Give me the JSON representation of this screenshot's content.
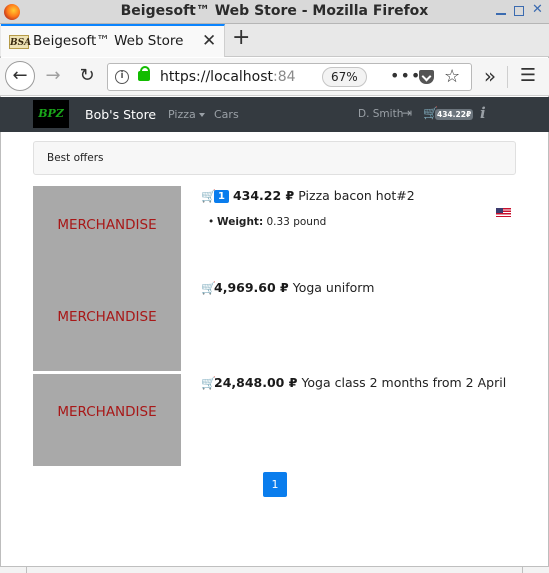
{
  "window": {
    "title": "Beigesoft™ Web Store - Mozilla Firefox",
    "minimize_icon": "minimize-icon",
    "maximize_icon": "maximize-icon",
    "close_glyph": "✕"
  },
  "tab": {
    "favicon_text": "BSA",
    "title": "Beigesoft™ Web Store",
    "close_glyph": "✕",
    "new_tab_glyph": "+"
  },
  "toolbar": {
    "back_glyph": "←",
    "forward_glyph": "→",
    "reload_glyph": "↻",
    "url_main": "https://localhost",
    "url_dim": ":84",
    "zoom": "67%",
    "more_glyph": "•••",
    "star_glyph": "☆",
    "overflow_glyph": "»",
    "menu_glyph": "☰"
  },
  "site": {
    "logo_text": "BPZ",
    "brand": "Bob's Store",
    "nav": [
      {
        "label": "Pizza",
        "has_dropdown": true
      },
      {
        "label": "Cars",
        "has_dropdown": false
      }
    ],
    "user": "D. Smith",
    "login_glyph": "⇥",
    "cart_glyph": "🛒",
    "cart_total": "434.22₽",
    "info_glyph": "i",
    "flag": "us-flag-icon",
    "brand_color": "#343a40",
    "accent": "#0a7ded"
  },
  "breadcrumb": {
    "label": "Best offers"
  },
  "products": [
    {
      "image_text": "MERCHANDISE",
      "in_cart_qty": "1",
      "price": "434.22 ₽",
      "name": "Pizza bacon hot#2",
      "props": [
        {
          "name": "Weight:",
          "value": "0.33 pound"
        }
      ]
    },
    {
      "image_text": "MERCHANDISE",
      "in_cart_qty": null,
      "price": "4,969.60 ₽",
      "name": "Yoga uniform",
      "props": []
    },
    {
      "image_text": "MERCHANDISE",
      "in_cart_qty": null,
      "price": "24,848.00 ₽",
      "name": "Yoga class 2 months from 2 April",
      "props": []
    }
  ],
  "pagination": {
    "pages": [
      "1"
    ],
    "current": "1"
  }
}
